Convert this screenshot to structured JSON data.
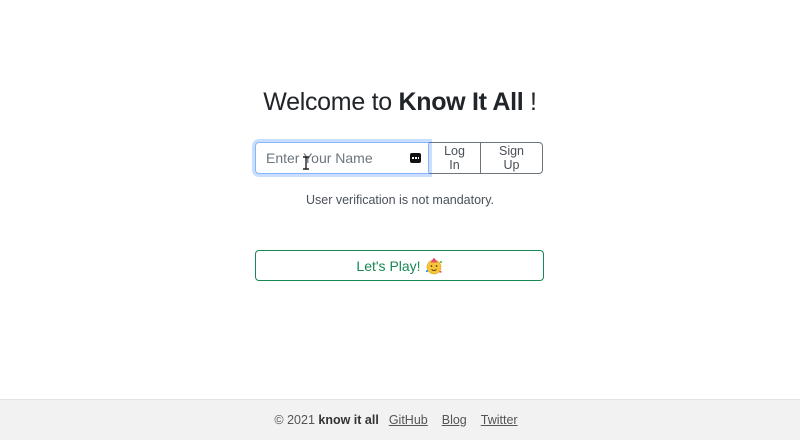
{
  "heading": {
    "prefix": "Welcome to ",
    "brand": "Know It All",
    "suffix": " !"
  },
  "login": {
    "name_placeholder": "Enter Your Name",
    "name_value": "",
    "login_label": "Log In",
    "signup_label": "Sign Up"
  },
  "note": "User verification is not mandatory.",
  "play": {
    "label": "Let's Play!",
    "icon": "partying-face-emoji"
  },
  "footer": {
    "copyright_prefix": "© 2021",
    "copyright_brand": "know it all",
    "links": [
      "GitHub",
      "Blog",
      "Twitter"
    ]
  },
  "colors": {
    "text": "#212529",
    "focus_ring": "#86b7fe",
    "success": "#198754",
    "footer_bg": "#f2f2f2"
  }
}
